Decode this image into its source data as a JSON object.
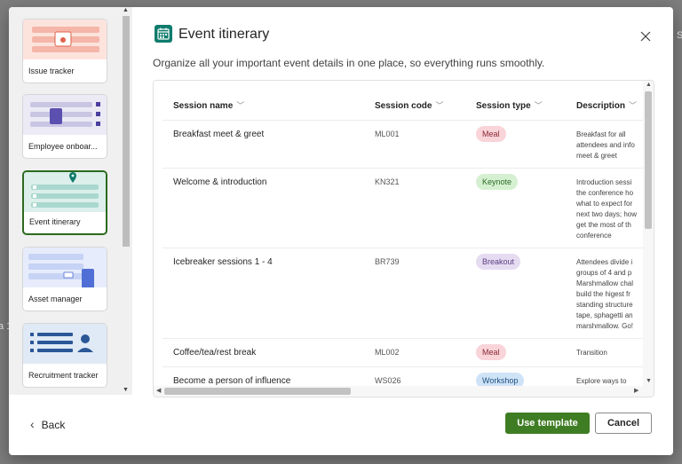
{
  "backdrop": {
    "left_fragment": "a 1",
    "right_fragment": "S"
  },
  "gallery": {
    "items": [
      {
        "label": "Issue tracker"
      },
      {
        "label": "Employee onboar..."
      },
      {
        "label": "Event itinerary",
        "selected": true
      },
      {
        "label": "Asset manager"
      },
      {
        "label": "Recruitment tracker"
      }
    ]
  },
  "header": {
    "icon": "calendar-icon",
    "title": "Event itinerary",
    "subtitle": "Organize all your important event details in one place, so everything runs smoothly."
  },
  "table": {
    "columns": [
      "Session name",
      "Session code",
      "Session type",
      "Description"
    ],
    "rows": [
      {
        "name": "Breakfast meet & greet",
        "code": "ML001",
        "type": "Meal",
        "description": "Breakfast for all\nattendees and info\nmeet & greet"
      },
      {
        "name": "Welcome & introduction",
        "code": "KN321",
        "type": "Keynote",
        "description": "Introduction sessi\nthe conference ho\nwhat to expect for\nnext two days; how\nget the most of th\nconference"
      },
      {
        "name": "Icebreaker sessions 1 - 4",
        "code": "BR739",
        "type": "Breakout",
        "description": "Attendees divide i\ngroups of 4 and p\nMarshmallow chal\nbuild the higest fr\nstanding structure\ntape, sphagetti an\nmarshmallow. Go!"
      },
      {
        "name": "Coffee/tea/rest break",
        "code": "ML002",
        "type": "Meal",
        "description": "Transition"
      },
      {
        "name": "Become a person of influence",
        "code": "WS026",
        "type": "Workshop",
        "description": "Explore ways to"
      }
    ],
    "type_colors": {
      "Meal": {
        "bg": "#f9d4d9",
        "fg": "#8a2a35"
      },
      "Keynote": {
        "bg": "#d5f0d1",
        "fg": "#2a6b24"
      },
      "Breakout": {
        "bg": "#e6dcf2",
        "fg": "#5a3d80"
      },
      "Workshop": {
        "bg": "#cfe3f7",
        "fg": "#1f4f80"
      }
    }
  },
  "footer": {
    "back_label": "Back",
    "use_template_label": "Use template",
    "cancel_label": "Cancel"
  },
  "colors": {
    "accent": "#3f7d24",
    "icon_bg": "#0f7c6c"
  }
}
